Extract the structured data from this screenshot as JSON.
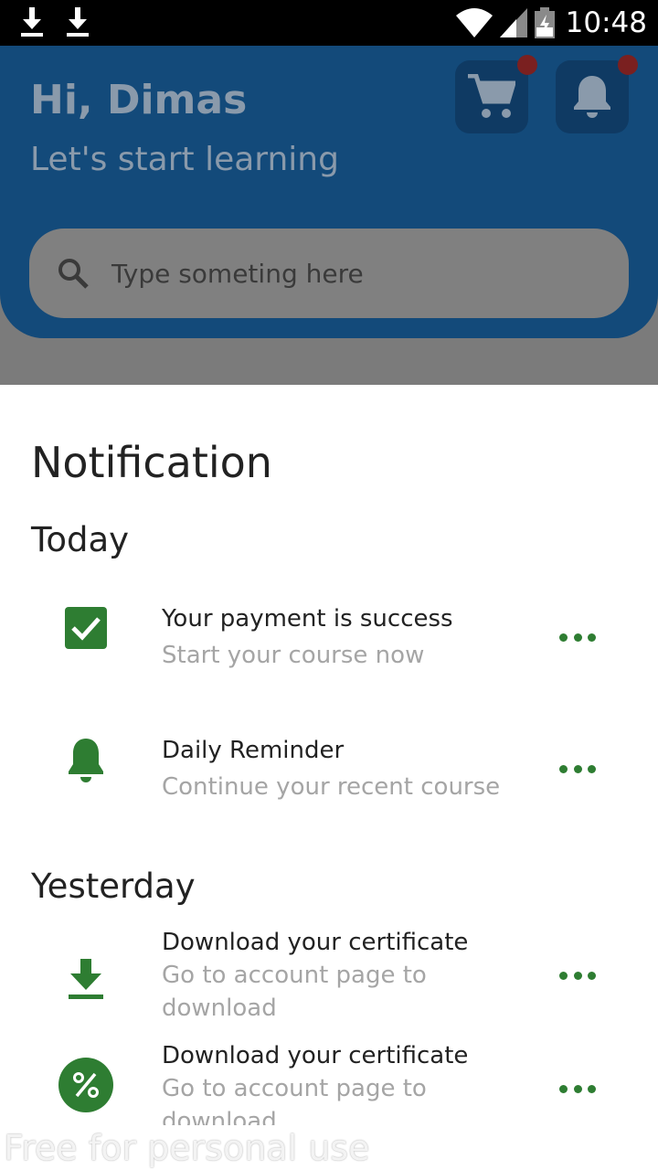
{
  "status_bar": {
    "time": "10:48",
    "icons": [
      "download-icon",
      "download-icon",
      "wifi-icon",
      "signal-icon",
      "battery-icon"
    ]
  },
  "header": {
    "greeting": "Hi, Dimas",
    "subtitle": "Let's start learning",
    "cart_icon": "cart-icon",
    "bell_icon": "bell-icon"
  },
  "search": {
    "placeholder": "Type someting here"
  },
  "sheet": {
    "title": "Notification",
    "sections": [
      {
        "label": "Today",
        "items": [
          {
            "icon": "check-square-icon",
            "title": "Your payment is success",
            "subtitle": "Start your course now"
          },
          {
            "icon": "bell-icon",
            "title": "Daily Reminder",
            "subtitle": "Continue your recent course"
          }
        ]
      },
      {
        "label": "Yesterday",
        "items": [
          {
            "icon": "download-icon",
            "title": "Download your certificate",
            "subtitle": "Go to account page to download"
          },
          {
            "icon": "percent-badge-icon",
            "title": "Download your certificate",
            "subtitle": "Go to account page to download"
          }
        ]
      }
    ]
  },
  "watermark": "Free for personal use",
  "colors": {
    "accent_green": "#2e7d32",
    "header_blue": "#134a7a",
    "scrim": "#7b7b7b",
    "badge_red": "#7a2020"
  }
}
